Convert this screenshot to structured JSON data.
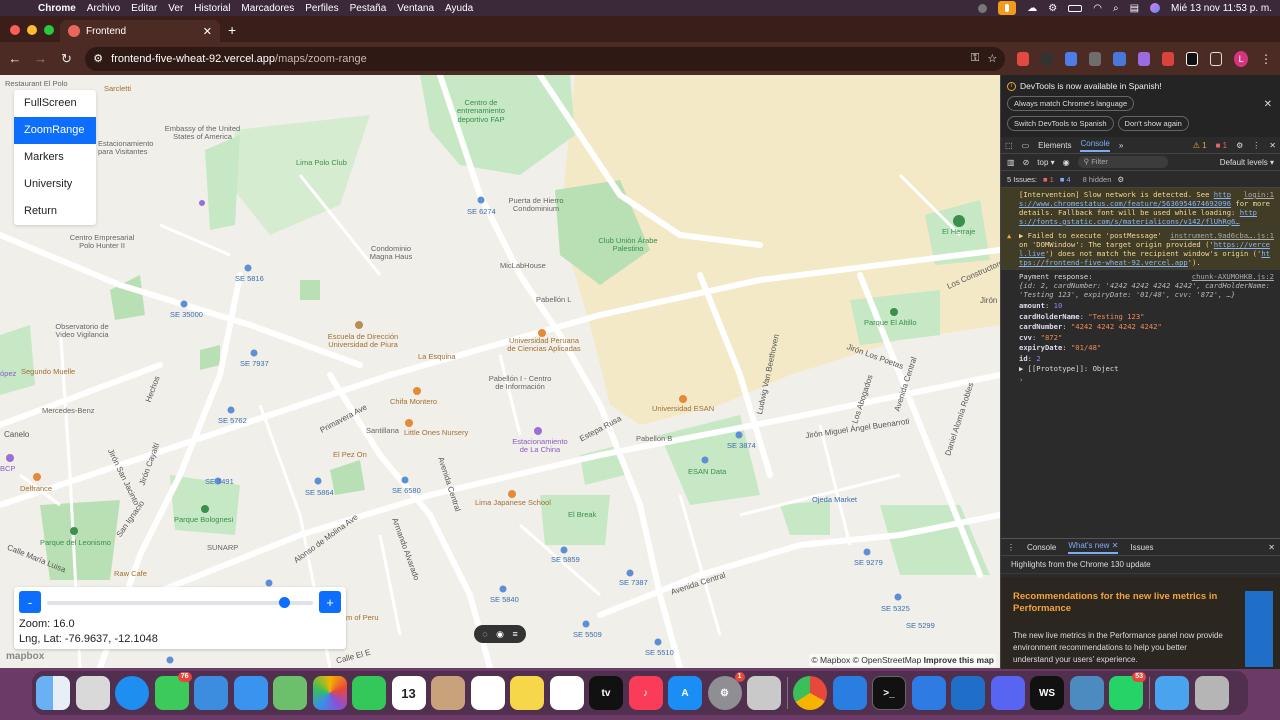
{
  "menubar": {
    "app": "Chrome",
    "items": [
      "Archivo",
      "Editar",
      "Ver",
      "Historial",
      "Marcadores",
      "Perfiles",
      "Pestaña",
      "Ventana",
      "Ayuda"
    ],
    "clock": "Mié 13 nov  11:53 p. m."
  },
  "browser": {
    "tab_title": "Frontend",
    "url_host": "frontend-five-wheat-92.vercel.app",
    "url_path": "/maps/zoom-range",
    "profile_initial": "L"
  },
  "side_menu": {
    "items": [
      "FullScreen",
      "ZoomRange",
      "Markers",
      "University",
      "Return"
    ],
    "active": "ZoomRange"
  },
  "zoom_panel": {
    "minus": "-",
    "plus": "+",
    "zoom_text": "Zoom: 16.0",
    "lnglat_text": "Lng, Lat: -76.9637, -12.1048",
    "slider_fraction": 0.89
  },
  "map": {
    "attribution_mapbox": "© Mapbox",
    "attribution_osm": "© OpenStreetMap",
    "attribution_improve": "Improve this map",
    "logo": "mapbox",
    "labels": {
      "restaurant": "Restaurant El Polo",
      "sarcletti": "Sarcletti",
      "embassy": "Embassy of the United States of America",
      "estacionamiento_visitantes": "Estacionamiento para Visitantes",
      "lima_polo": "Lima Polo Club",
      "centro_fap": "Centro de entrenamiento deportivo FAP",
      "puerta_hierro": "Puerta de Hierro Condominium",
      "club_arabe": "Club Unión Árabe Palestino",
      "el_herraje": "El Herraje",
      "los_constructores": "Los Constructores",
      "centro_polo": "Centro Empresarial Polo Hunter II",
      "condominio_magna": "Condominio Magna Haus",
      "miclab": "MicLabHouse",
      "pabellon_l": "Pabellón L",
      "se6274": "SE 6274",
      "se5816": "SE 5816",
      "se35000": "SE 35000",
      "observatorio": "Observatorio de Video Vigilancia",
      "escuela_piura": "Escuela de Dirección Universidad de Piura",
      "la_esquina": "La Esquina",
      "upc": "Universidad Peruana de Ciencias Aplicadas",
      "parque_altillo": "Parque El Altillo",
      "jiron_poetas": "Jirón Los Poetas",
      "segundo_muelle": "Segundo Muelle",
      "se7937": "SE 7937",
      "pabellon_i": "Pabellón I - Centro de Información",
      "chifa": "Chifa Montero",
      "u_esan": "Universidad ESAN",
      "ludwig": "Ludwig Van Beethoven",
      "los_abogados": "Los Abogados",
      "avenida_central_r": "Avenida Central",
      "daniel_robles": "Daniel Alomía Robles",
      "mercedes": "Mercedes-Benz",
      "primavera": "Primavera Ave",
      "santillana": "Santillana",
      "little_ones": "Little Ones Nursery",
      "se5762": "SE 5762",
      "estac_china": "Estacionamiento de La China",
      "estepa_rusa": "Estepa Rusa",
      "pabellon_b": "Pabellón B",
      "se3874": "SE 3874",
      "jiron_buenarroti": "Jirón Miguel Ángel Buenarroti",
      "esan_data": "ESAN Data",
      "el_pez_on": "El Pez On",
      "avenida_central_m": "Avenida Central",
      "se7491": "SE 7491",
      "se5864": "SE 5864",
      "se6580": "SE 6580",
      "lima_japanese": "Lima Japanese School",
      "el_break": "El Break",
      "ojeda": "Ojeda Market",
      "delfrance": "Delfrance",
      "parque_bolognesi": "Parque Bolognesi",
      "jiron_cayalti": "Jirón Cayaltí",
      "jiron_san_jacinto": "Jirón San Jacinto",
      "san_ignacio": "San Ignacio",
      "parque_leonismo": "Parque del Leonismo",
      "alonso_molina": "Alonso de Molina Ave",
      "armando_alvarado": "Armando Alvarado",
      "sunarp": "SUNARP",
      "calle_maria_luisa": "Calle María Luisa",
      "raw_cafe": "Raw Cafe",
      "se5859": "SE 5859",
      "se7387": "SE 7387",
      "se5840": "SE 5840",
      "avenida_central_b": "Avenida Central",
      "se9279": "SE 9279",
      "se5325": "SE 5325",
      "se5299": "SE 5299",
      "se5509": "SE 5509",
      "se5510": "SE 5510",
      "canelo": "Canelo",
      "hechos": "Hechos",
      "el_bcp": "BCP",
      "lopez": "ópez",
      "jiron": "Jirón",
      "calle_el": "Calle El E",
      "peru": "m of Peru"
    }
  },
  "devtools": {
    "banner_text": "DevTools is now available in Spanish!",
    "banner_buttons": [
      "Always match Chrome's language",
      "Switch DevTools to Spanish",
      "Don't show again"
    ],
    "tabs": [
      "Elements",
      "Console"
    ],
    "active_tab": "Console",
    "warn_count": "1",
    "err_count": "1",
    "context": "top",
    "filter_placeholder": "Filter",
    "levels": "Default levels",
    "issues_label": "5 Issues:",
    "issues_err": "1",
    "issues_info": "4",
    "hidden": "8 hidden",
    "entries": {
      "e1_text": "[Intervention] Slow network is detected. See",
      "e1_link": "https://www.chromestatus.com/feature/5636954674692096",
      "e1_tail": "for more details. Fallback font will be used while loading:",
      "e1_link2": "https://fonts.gstatic.com/s/materialicons/v142/flUhRq6…",
      "e1_src": "login:1",
      "e2_text": "▶ Failed to execute 'postMessage' on 'DOMWindow': The target origin provided ('",
      "e2_link": "https://vercel.live",
      "e2_mid": "') does not match the recipient window's origin ('",
      "e2_link2": "https://frontend-five-wheat-92.vercel.app",
      "e2_end": "').",
      "e2_src": "instrument.9ad6cba….js:1",
      "e3_label": "Payment response:",
      "e3_src": "chunk-AXUMOHKB.js:2",
      "e3_preview": "{id: 2, cardNumber: '4242 4242 4242 4242', cardHolderName: 'Testing 123', expiryDate: '01/48', cvv: '872', …}"
    },
    "object": [
      {
        "k": "amount",
        "v": "10",
        "t": "num"
      },
      {
        "k": "cardHolderName",
        "v": "\"Testing 123\"",
        "t": "str"
      },
      {
        "k": "cardNumber",
        "v": "\"4242 4242 4242 4242\"",
        "t": "str"
      },
      {
        "k": "cvv",
        "v": "\"872\"",
        "t": "str"
      },
      {
        "k": "expiryDate",
        "v": "\"01/48\"",
        "t": "str"
      },
      {
        "k": "id",
        "v": "2",
        "t": "num"
      }
    ],
    "prototype": "▶ [[Prototype]]: Object",
    "drawer_tabs": [
      "Console",
      "What's new",
      "Issues"
    ],
    "drawer_active": "What's new",
    "highlights": "Highlights from the Chrome 130 update",
    "wn_title": "Recommendations for the new live metrics in Performance",
    "wn_body": "The new live metrics in the Performance panel now provide environment recommendations to help you better understand your users' experience."
  },
  "dock": {
    "messages_badge": "76",
    "calendar_day": "13",
    "settings_badge": "1",
    "whatsapp_badge": "53",
    "ws_label": "WS"
  }
}
